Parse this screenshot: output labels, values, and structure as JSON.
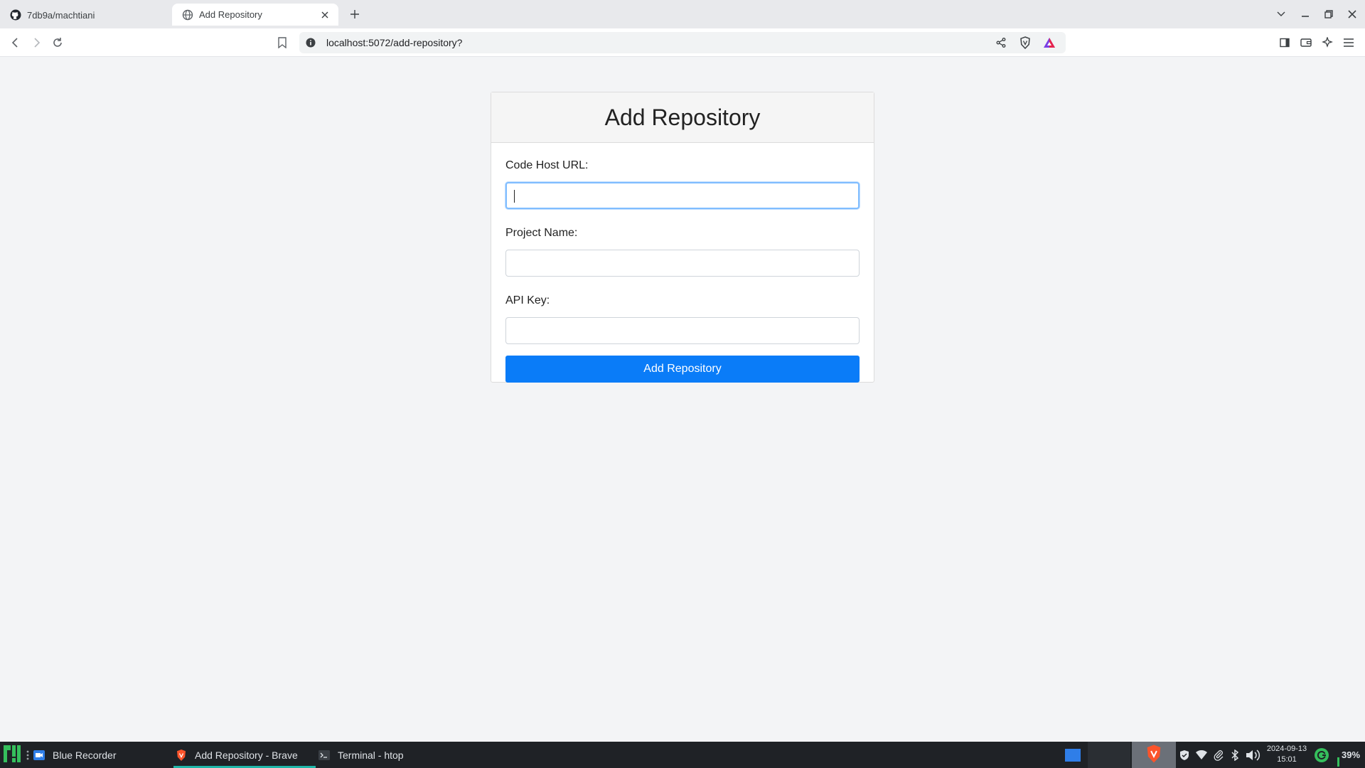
{
  "browser": {
    "tabs": [
      {
        "title": "7db9a/machtiani",
        "icon": "github-icon"
      },
      {
        "title": "Add Repository",
        "icon": "globe-icon"
      }
    ],
    "url": "localhost:5072/add-repository?"
  },
  "form": {
    "heading": "Add Repository",
    "fields": [
      {
        "label": "Code Host URL:",
        "value": ""
      },
      {
        "label": "Project Name:",
        "value": ""
      },
      {
        "label": "API Key:",
        "value": ""
      }
    ],
    "submit_label": "Add Repository"
  },
  "taskbar": {
    "items": [
      {
        "label": "Blue Recorder",
        "icon": "recorder-icon"
      },
      {
        "label": "Add Repository - Brave",
        "icon": "brave-icon"
      },
      {
        "label": "Terminal - htop",
        "icon": "terminal-icon"
      }
    ],
    "date": "2024-09-13",
    "time": "15:01",
    "battery": "39%"
  },
  "colors": {
    "accent": "#0a7cf8",
    "focus_ring": "#80bdff",
    "taskbar_active": "#1fb6a8"
  }
}
